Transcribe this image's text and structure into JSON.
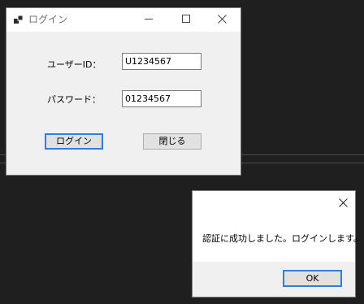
{
  "login_window": {
    "title": "ログイン",
    "icon": "app-window-icon",
    "controls": {
      "minimize_icon": "minimize-icon",
      "maximize_icon": "maximize-icon",
      "close_icon": "close-icon"
    },
    "fields": {
      "userid_label": "ユーザーID：",
      "userid_value": "U1234567",
      "password_label": "パスワード：",
      "password_value": "01234567"
    },
    "buttons": {
      "login_label": "ログイン",
      "close_label": "閉じる"
    }
  },
  "message_box": {
    "message": "認証に成功しました。ログインします。",
    "ok_label": "OK",
    "close_icon": "close-icon"
  },
  "colors": {
    "desktop_background": "#1f1f1f",
    "window_background": "#f0f0f0",
    "focus_border": "#2f7ed8",
    "button_face": "#e1e1e1"
  }
}
